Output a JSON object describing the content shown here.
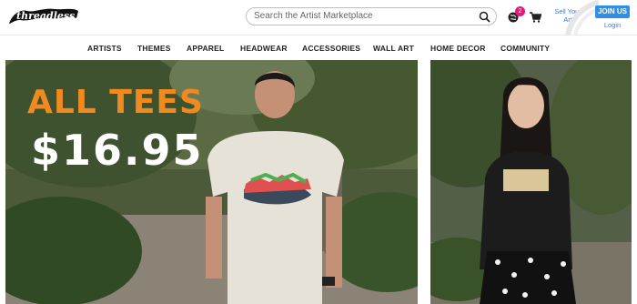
{
  "header": {
    "logo_text": "threadless",
    "search_placeholder": "Search the Artist Marketplace",
    "notification_count": "2",
    "sell_label": "Sell Your Art",
    "join_label": "JOIN US",
    "login_label": "Login"
  },
  "nav": {
    "items": [
      "ARTISTS",
      "THEMES",
      "APPAREL",
      "HEADWEAR",
      "ACCESSORIES",
      "WALL ART",
      "HOME DECOR",
      "COMMUNITY"
    ]
  },
  "hero": {
    "promo_line1": "ALL TEES",
    "promo_line2": "$16.95"
  },
  "colors": {
    "promo_orange": "#f08a1f",
    "join_blue": "#2f8fe6",
    "badge_pink": "#e51a78",
    "link_blue": "#3a7bd5"
  }
}
